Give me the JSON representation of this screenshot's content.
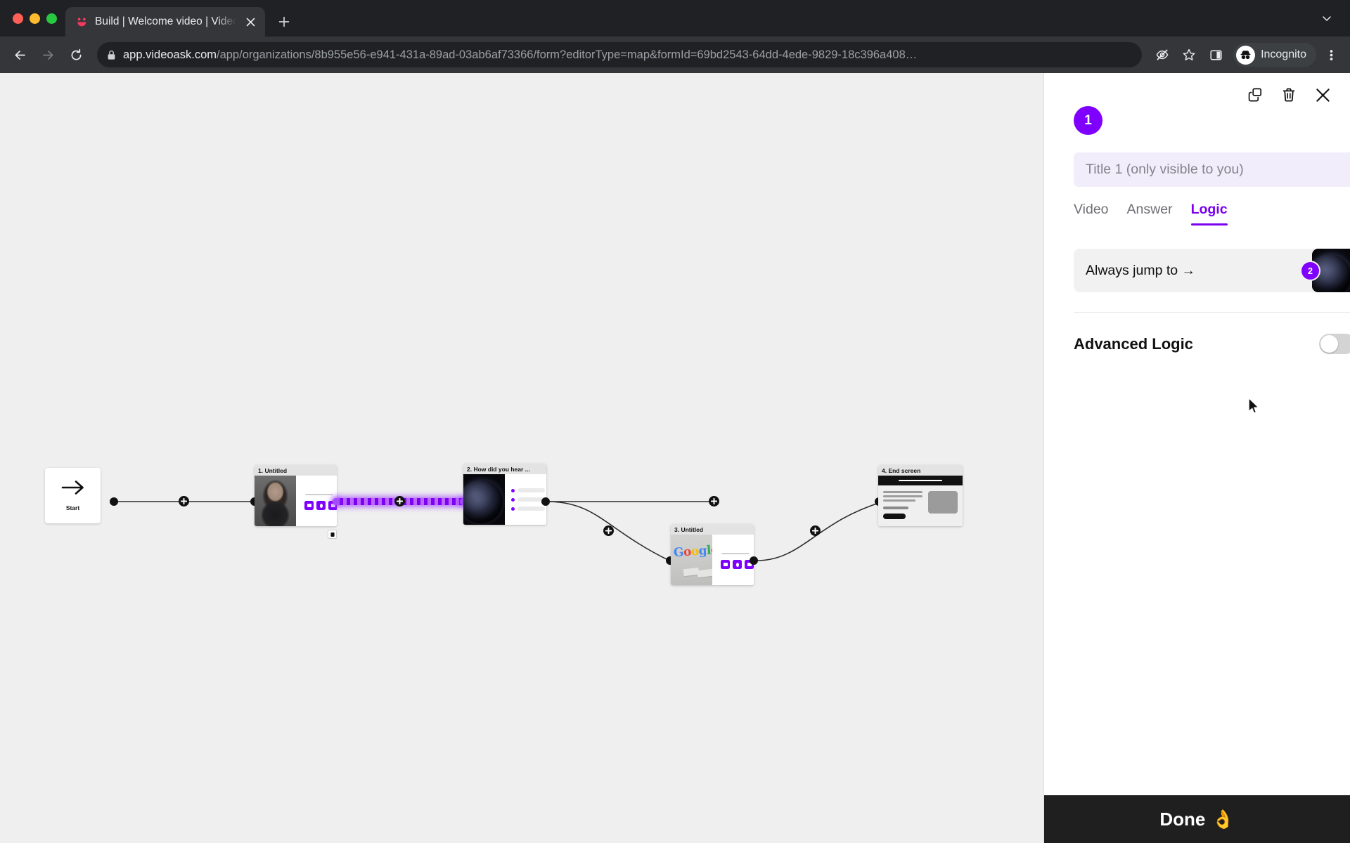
{
  "browser": {
    "tab": {
      "title": "Build | Welcome video | VideoAsk",
      "favicon": "videoask-smiley-icon",
      "close": "×"
    },
    "new_tab_label": "+",
    "nav": {
      "back": "back-icon",
      "forward": "forward-icon",
      "reload": "reload-icon"
    },
    "omnibox": {
      "lock": "lock-icon",
      "host": "app.videoask.com",
      "path": "/app/organizations/8b955e56-e941-431a-89ad-03ab6af73366/form?editorType=map&formId=69bd2543-64dd-4ede-9829-18c396a408…"
    },
    "toolbar": {
      "tracking_icon": "eye-off-icon",
      "bookmark_icon": "star-icon",
      "sidepanel_icon": "side-panel-icon",
      "profile_label": "Incognito",
      "menu_icon": "three-dot-menu-icon"
    }
  },
  "canvas": {
    "start": {
      "label": "Start",
      "icon": "arrow-right-icon"
    },
    "nodes": [
      {
        "id": "1",
        "title": "1. Untitled",
        "thumb": "woman-video-thumbnail",
        "kind": "video"
      },
      {
        "id": "2",
        "title": "2. How did you hear ...",
        "thumb": "space-planet-thumbnail",
        "kind": "multiple-choice"
      },
      {
        "id": "3",
        "title": "3. Untitled",
        "thumb": "google-logo-thumbnail",
        "kind": "video"
      },
      {
        "id": "4",
        "title": "4. End screen",
        "thumb": "end-screen-thumbnail",
        "kind": "end"
      }
    ],
    "add_button_label": "+",
    "active_connection": "1-to-2"
  },
  "panel": {
    "actions": {
      "duplicate": "duplicate-icon",
      "delete": "trash-icon",
      "close": "close-icon"
    },
    "step_number": "1",
    "title_placeholder": "Title 1 (only visible to you)",
    "tabs": [
      {
        "label": "Video",
        "active": false
      },
      {
        "label": "Answer",
        "active": false
      },
      {
        "label": "Logic",
        "active": true
      }
    ],
    "jump": {
      "label": "Always jump to →",
      "target_number": "2",
      "target_thumb": "space-planet-thumbnail"
    },
    "advanced_logic": {
      "label": "Advanced Logic",
      "enabled": false
    },
    "done_label": "Done",
    "done_emoji": "👌"
  },
  "colors": {
    "accent": "#7f00ff",
    "panel_bg": "#ffffff",
    "canvas_bg": "#efefef",
    "chrome_bg": "#35363a",
    "bottom_bar": "#1f1f1f"
  }
}
